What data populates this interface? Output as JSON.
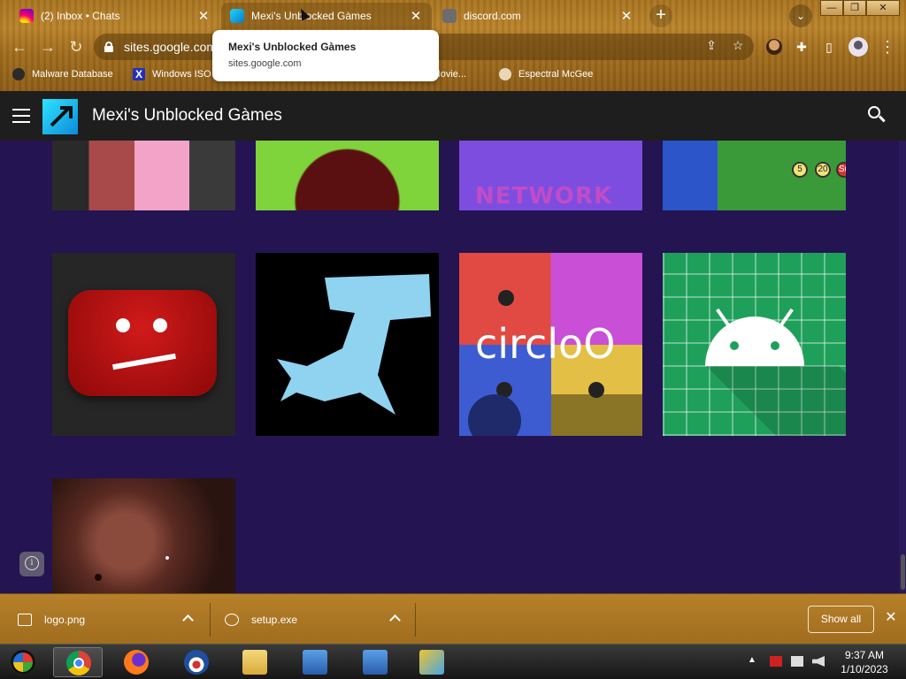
{
  "browser": {
    "tabs": [
      {
        "title": "(2) Inbox • Chats",
        "favicon": "instagram-icon"
      },
      {
        "title": "Mexi's Unblocked Gàmes",
        "favicon": "pickaxe-logo-icon",
        "active": true
      },
      {
        "title": "discord.com",
        "favicon": "discord-icon"
      }
    ],
    "new_tab": "+",
    "tab_search": "⌄",
    "window": {
      "minimize": "—",
      "maximize": "❐",
      "close": "✕"
    },
    "address": "sites.google.com",
    "bookmarks": [
      "Malware Database",
      "Windows ISO",
      "x Movie...",
      "Espectral McGee"
    ],
    "tooltip": {
      "title": "Mexi's Unblocked Gàmes",
      "url": "sites.google.com"
    }
  },
  "site": {
    "title": "Mexi's Unblocked Gàmes",
    "accent": "#241452",
    "games": [
      {
        "name": "roblox-characters-thumbnail"
      },
      {
        "name": "venus-flytrap-thumbnail"
      },
      {
        "name": "network-thumbnail",
        "text": "NETWORK"
      },
      {
        "name": "map-game-thumbnail",
        "badges": [
          "5",
          "20",
          "Su"
        ]
      },
      {
        "name": "sad-youtube-thumbnail"
      },
      {
        "name": "hammerhead-shark-thumbnail"
      },
      {
        "name": "circloo-thumbnail",
        "text": "circloO"
      },
      {
        "name": "android-thumbnail"
      },
      {
        "name": "face-thumbnail"
      }
    ]
  },
  "downloads": {
    "items": [
      {
        "filename": "logo.png",
        "icon": "image-file-icon"
      },
      {
        "filename": "setup.exe",
        "icon": "setup-file-icon"
      }
    ],
    "show_all": "Show all",
    "close": "✕"
  },
  "taskbar": {
    "apps": [
      "start-orb",
      "chrome",
      "firefox",
      "obama-logo",
      "file-explorer",
      "program-1",
      "program-2",
      "network-program"
    ],
    "tray_arrow": "▲",
    "time": "9:37 AM",
    "date": "1/10/2023"
  }
}
